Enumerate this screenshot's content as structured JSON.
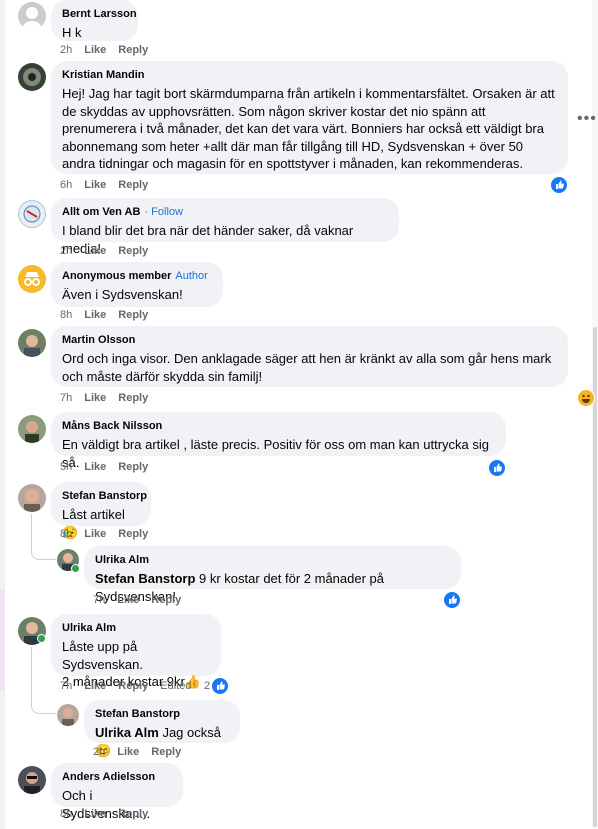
{
  "comments": [
    {
      "author": "Bernt Larsson",
      "text": "H k",
      "time": "2h",
      "like": "Like",
      "reply": "Reply"
    },
    {
      "author": "Kristian Mandin",
      "text": "Hej! Jag har tagit bort skärmdumparna från artikeln i kommentarsfältet. Orsaken är att de skyddas av upphovsrätten. Som någon skriver kostar det nio spänn att prenumerera i två månader, det kan det vara värt. Bonniers har också ett väldigt bra abonnemang som heter +allt där man får tillgång till HD, Sydsvenskan + över 50 andra tidningar och magasin för en spottstyver i månaden, kan rekommenderas.",
      "time": "6h",
      "like": "Like",
      "reply": "Reply",
      "reaction": "like"
    },
    {
      "author": "Allt om Ven AB",
      "tag": "· Follow",
      "text": "I bland blir det bra när det händer saker, då vaknar media!",
      "time": "2h",
      "like": "Like",
      "reply": "Reply"
    },
    {
      "author": "Anonymous member",
      "tag": "Author",
      "text": "Även i Sydsvenskan!",
      "time": "8h",
      "like": "Like",
      "reply": "Reply"
    },
    {
      "author": "Martin Olsson",
      "text": "Ord och inga visor. Den anklagade säger att hen är kränkt av alla som går hens mark och måste därför skydda sin familj!",
      "time": "7h",
      "like": "Like",
      "reply": "Reply",
      "reaction": "haha"
    },
    {
      "author": "Måns Back Nilsson",
      "text": "En väldigt bra artikel , läste precis. Positiv för oss om man kan uttrycka sig så.",
      "time": "5h",
      "like": "Like",
      "reply": "Reply",
      "reaction": "like"
    },
    {
      "author": "Stefan Banstorp",
      "text": "Låst artikel 😥",
      "time": "8h",
      "like": "Like",
      "reply": "Reply"
    },
    {
      "author": "Ulrika Alm",
      "mention": "Stefan Banstorp",
      "text": " 9 kr kostar det för 2 månader på Sydsvenskan!",
      "time": "7h",
      "like": "Like",
      "reply": "Reply",
      "reaction": "like"
    },
    {
      "author": "Ulrika Alm",
      "text1": "Låste upp på Sydsvenskan.",
      "text2": "2 månader kostar 9kr👍",
      "time": "7h",
      "like": "Like",
      "reply": "Reply",
      "edited": "Edited",
      "reaction_count": "2",
      "reaction": "like"
    },
    {
      "author": "Stefan Banstorp",
      "mention": "Ulrika Alm",
      "text": " Jag också 😊",
      "time": "2h",
      "like": "Like",
      "reply": "Reply"
    },
    {
      "author": "Anders Adielsson",
      "text": "Och i Sydsvenskan...",
      "time": "8h",
      "like": "Like",
      "reply": "Reply"
    }
  ],
  "more_options": "•••",
  "colors": {
    "bubble": "#f0f2f5",
    "link": "#216fdb",
    "meta": "#65676b",
    "like": "#1877f2"
  }
}
